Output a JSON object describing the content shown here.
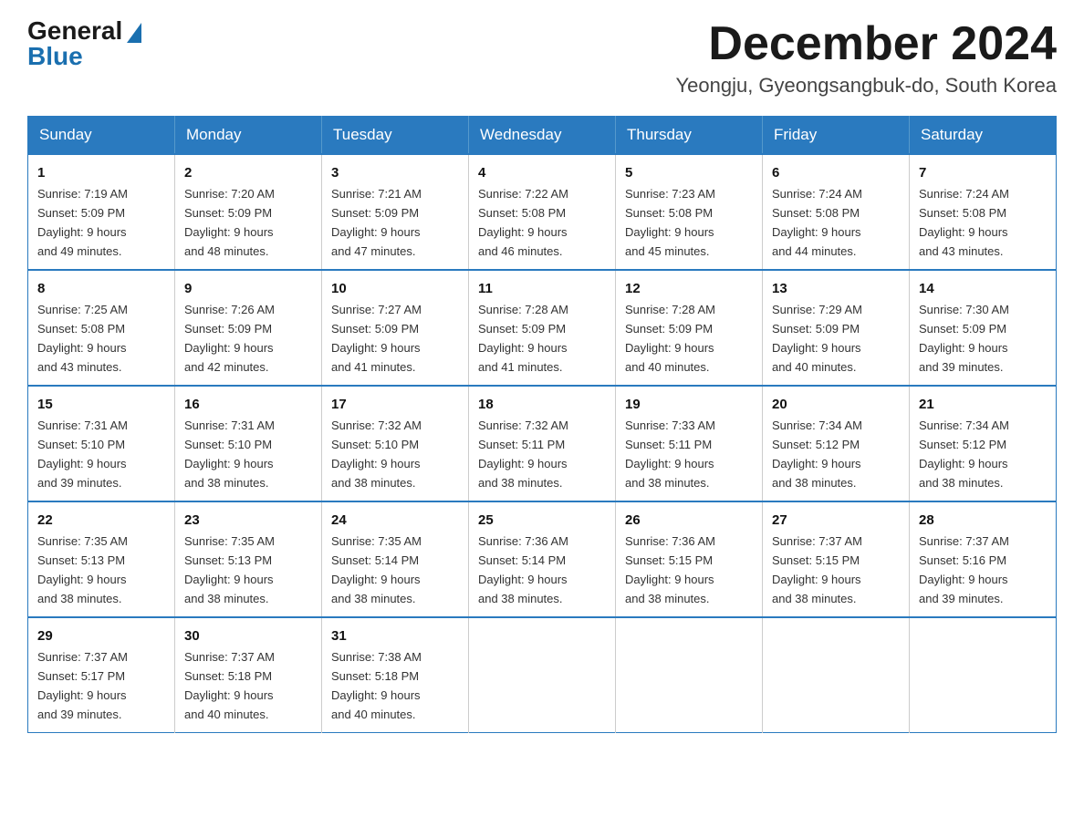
{
  "logo": {
    "general": "General",
    "blue": "Blue"
  },
  "header": {
    "month": "December 2024",
    "location": "Yeongju, Gyeongsangbuk-do, South Korea"
  },
  "weekdays": [
    "Sunday",
    "Monday",
    "Tuesday",
    "Wednesday",
    "Thursday",
    "Friday",
    "Saturday"
  ],
  "weeks": [
    [
      {
        "day": "1",
        "sunrise": "7:19 AM",
        "sunset": "5:09 PM",
        "daylight": "9 hours and 49 minutes."
      },
      {
        "day": "2",
        "sunrise": "7:20 AM",
        "sunset": "5:09 PM",
        "daylight": "9 hours and 48 minutes."
      },
      {
        "day": "3",
        "sunrise": "7:21 AM",
        "sunset": "5:09 PM",
        "daylight": "9 hours and 47 minutes."
      },
      {
        "day": "4",
        "sunrise": "7:22 AM",
        "sunset": "5:08 PM",
        "daylight": "9 hours and 46 minutes."
      },
      {
        "day": "5",
        "sunrise": "7:23 AM",
        "sunset": "5:08 PM",
        "daylight": "9 hours and 45 minutes."
      },
      {
        "day": "6",
        "sunrise": "7:24 AM",
        "sunset": "5:08 PM",
        "daylight": "9 hours and 44 minutes."
      },
      {
        "day": "7",
        "sunrise": "7:24 AM",
        "sunset": "5:08 PM",
        "daylight": "9 hours and 43 minutes."
      }
    ],
    [
      {
        "day": "8",
        "sunrise": "7:25 AM",
        "sunset": "5:08 PM",
        "daylight": "9 hours and 43 minutes."
      },
      {
        "day": "9",
        "sunrise": "7:26 AM",
        "sunset": "5:09 PM",
        "daylight": "9 hours and 42 minutes."
      },
      {
        "day": "10",
        "sunrise": "7:27 AM",
        "sunset": "5:09 PM",
        "daylight": "9 hours and 41 minutes."
      },
      {
        "day": "11",
        "sunrise": "7:28 AM",
        "sunset": "5:09 PM",
        "daylight": "9 hours and 41 minutes."
      },
      {
        "day": "12",
        "sunrise": "7:28 AM",
        "sunset": "5:09 PM",
        "daylight": "9 hours and 40 minutes."
      },
      {
        "day": "13",
        "sunrise": "7:29 AM",
        "sunset": "5:09 PM",
        "daylight": "9 hours and 40 minutes."
      },
      {
        "day": "14",
        "sunrise": "7:30 AM",
        "sunset": "5:09 PM",
        "daylight": "9 hours and 39 minutes."
      }
    ],
    [
      {
        "day": "15",
        "sunrise": "7:31 AM",
        "sunset": "5:10 PM",
        "daylight": "9 hours and 39 minutes."
      },
      {
        "day": "16",
        "sunrise": "7:31 AM",
        "sunset": "5:10 PM",
        "daylight": "9 hours and 38 minutes."
      },
      {
        "day": "17",
        "sunrise": "7:32 AM",
        "sunset": "5:10 PM",
        "daylight": "9 hours and 38 minutes."
      },
      {
        "day": "18",
        "sunrise": "7:32 AM",
        "sunset": "5:11 PM",
        "daylight": "9 hours and 38 minutes."
      },
      {
        "day": "19",
        "sunrise": "7:33 AM",
        "sunset": "5:11 PM",
        "daylight": "9 hours and 38 minutes."
      },
      {
        "day": "20",
        "sunrise": "7:34 AM",
        "sunset": "5:12 PM",
        "daylight": "9 hours and 38 minutes."
      },
      {
        "day": "21",
        "sunrise": "7:34 AM",
        "sunset": "5:12 PM",
        "daylight": "9 hours and 38 minutes."
      }
    ],
    [
      {
        "day": "22",
        "sunrise": "7:35 AM",
        "sunset": "5:13 PM",
        "daylight": "9 hours and 38 minutes."
      },
      {
        "day": "23",
        "sunrise": "7:35 AM",
        "sunset": "5:13 PM",
        "daylight": "9 hours and 38 minutes."
      },
      {
        "day": "24",
        "sunrise": "7:35 AM",
        "sunset": "5:14 PM",
        "daylight": "9 hours and 38 minutes."
      },
      {
        "day": "25",
        "sunrise": "7:36 AM",
        "sunset": "5:14 PM",
        "daylight": "9 hours and 38 minutes."
      },
      {
        "day": "26",
        "sunrise": "7:36 AM",
        "sunset": "5:15 PM",
        "daylight": "9 hours and 38 minutes."
      },
      {
        "day": "27",
        "sunrise": "7:37 AM",
        "sunset": "5:15 PM",
        "daylight": "9 hours and 38 minutes."
      },
      {
        "day": "28",
        "sunrise": "7:37 AM",
        "sunset": "5:16 PM",
        "daylight": "9 hours and 39 minutes."
      }
    ],
    [
      {
        "day": "29",
        "sunrise": "7:37 AM",
        "sunset": "5:17 PM",
        "daylight": "9 hours and 39 minutes."
      },
      {
        "day": "30",
        "sunrise": "7:37 AM",
        "sunset": "5:18 PM",
        "daylight": "9 hours and 40 minutes."
      },
      {
        "day": "31",
        "sunrise": "7:38 AM",
        "sunset": "5:18 PM",
        "daylight": "9 hours and 40 minutes."
      },
      null,
      null,
      null,
      null
    ]
  ],
  "labels": {
    "sunrise": "Sunrise:",
    "sunset": "Sunset:",
    "daylight": "Daylight:"
  }
}
